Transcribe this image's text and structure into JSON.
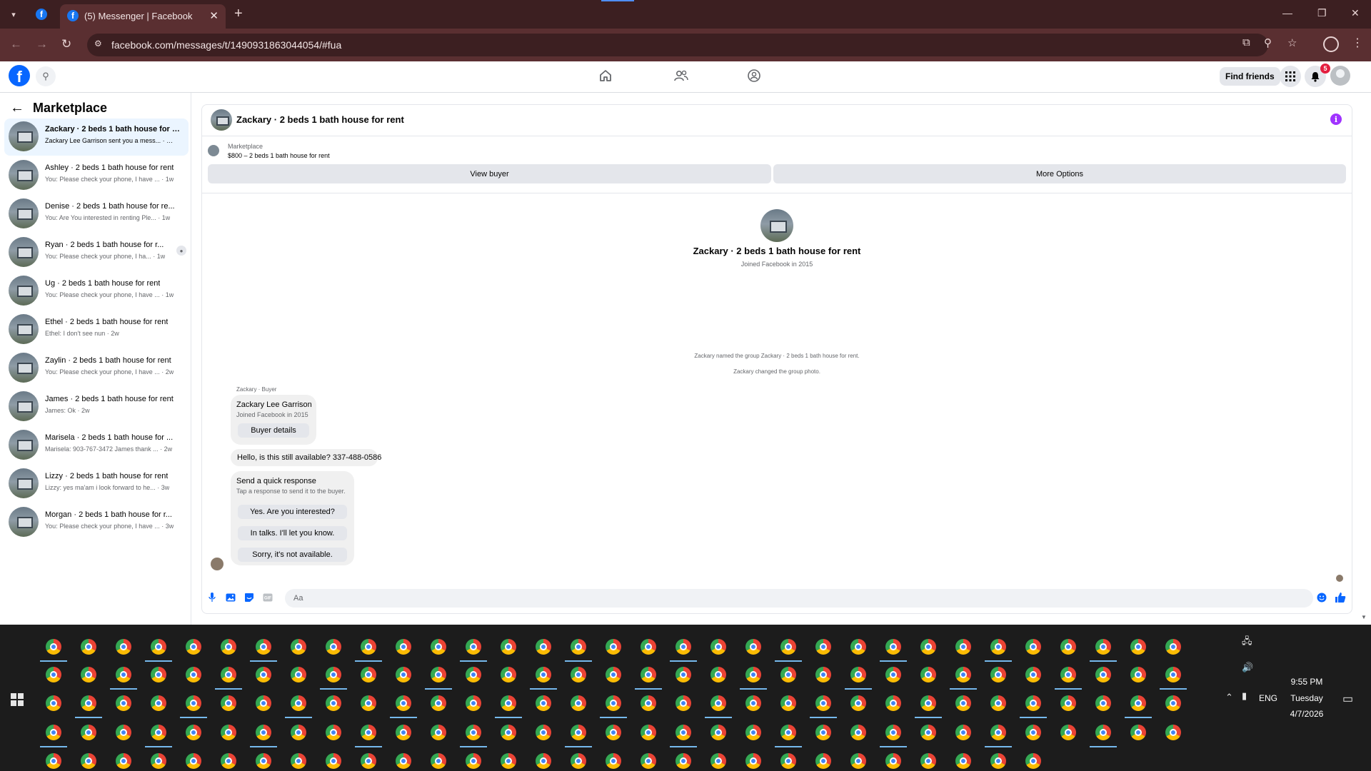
{
  "browser": {
    "tab_title": "(5) Messenger | Facebook",
    "tab_close": "✕",
    "new_tab": "+",
    "url": "facebook.com/messages/t/1490931863044054/#fua"
  },
  "fbnav": {
    "find_friends": "Find friends",
    "notification_count": "5"
  },
  "sidebar": {
    "title": "Marketplace",
    "conversations": [
      {
        "name": "Zackary · 2 beds 1 bath house for r...",
        "preview": "Zackary Lee Garrison sent you a mess... · 1m"
      },
      {
        "name": "Ashley · 2 beds 1 bath house for rent",
        "preview": "You: Please check your phone, I have ... · 1w"
      },
      {
        "name": "Denise · 2 beds 1 bath house for re...",
        "preview": "You: Are You interested in renting Ple... · 1w"
      },
      {
        "name": "Ryan · 2 beds 1 bath house for r...",
        "preview": "You: Please check your phone, I ha... · 1w"
      },
      {
        "name": "Ug · 2 beds 1 bath house for rent",
        "preview": "You: Please check your phone, I have ... · 1w"
      },
      {
        "name": "Ethel · 2 beds 1 bath house for rent",
        "preview": "Ethel: I don't see nun · 2w"
      },
      {
        "name": "Zaylin · 2 beds 1 bath house for rent",
        "preview": "You: Please check your phone, I have ... · 2w"
      },
      {
        "name": "James · 2 beds 1 bath house for rent",
        "preview": "James: Ok · 2w"
      },
      {
        "name": "Marisela · 2 beds 1 bath house for ...",
        "preview": "Marisela: 903-767-3472 James thank ... · 2w"
      },
      {
        "name": "Lizzy · 2 beds 1 bath house for rent",
        "preview": "Lizzy: yes ma'am i look forward to he... · 3w"
      },
      {
        "name": "Morgan · 2 beds 1 bath house for r...",
        "preview": "You: Please check your phone, I have ... · 3w"
      }
    ]
  },
  "chat": {
    "title": "Zackary · 2 beds 1 bath house for rent",
    "marketplace_label": "Marketplace",
    "listing": "$800 – 2 beds 1 bath house for rent",
    "view_buyer": "View buyer",
    "more_options": "More Options",
    "intro_name": "Zackary · 2 beds 1 bath house for rent",
    "intro_sub": "Joined Facebook in 2015",
    "system_messages": [
      "Zackary named the group Zackary · 2 beds 1 bath house for rent.",
      "Zackary changed the group photo."
    ],
    "sender_label": "Zackary · Buyer",
    "buyer_card": {
      "name": "Zackary Lee Garrison",
      "sub": "Joined Facebook in 2015",
      "button": "Buyer details"
    },
    "message": "Hello, is this still available? 337-488-0586",
    "quick_response": {
      "title": "Send a quick response",
      "sub": "Tap a response to send it to the buyer.",
      "options": [
        "Yes. Are you interested?",
        "In talks. I'll let you know.",
        "Sorry, it's not available."
      ]
    },
    "composer_placeholder": "Aa"
  },
  "taskbar": {
    "language": "ENG",
    "time": "9:55 PM",
    "day": "Tuesday",
    "date": "4/7/2026"
  }
}
